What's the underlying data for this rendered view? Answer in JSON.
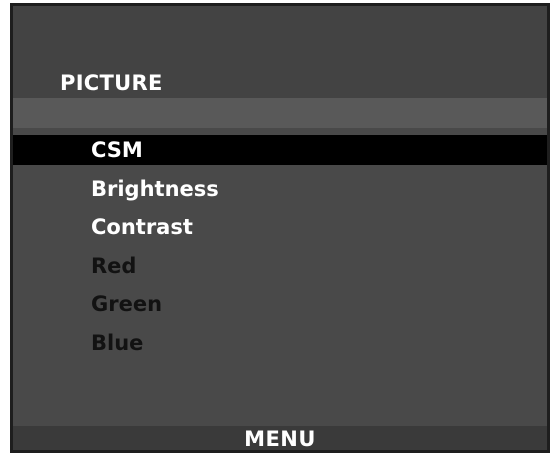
{
  "osd": {
    "title": "PICTURE",
    "items": [
      {
        "label": "CSM",
        "state": "selected"
      },
      {
        "label": "Brightness",
        "state": "enabled"
      },
      {
        "label": "Contrast",
        "state": "enabled"
      },
      {
        "label": "Red",
        "state": "disabled"
      },
      {
        "label": "Green",
        "state": "disabled"
      },
      {
        "label": "Blue",
        "state": "disabled"
      }
    ],
    "footer_label": "MENU"
  },
  "colors": {
    "panel_background": "#4a4a4a",
    "highlight_background": "#000000",
    "enabled_text": "#ffffff",
    "disabled_text": "#121212"
  }
}
